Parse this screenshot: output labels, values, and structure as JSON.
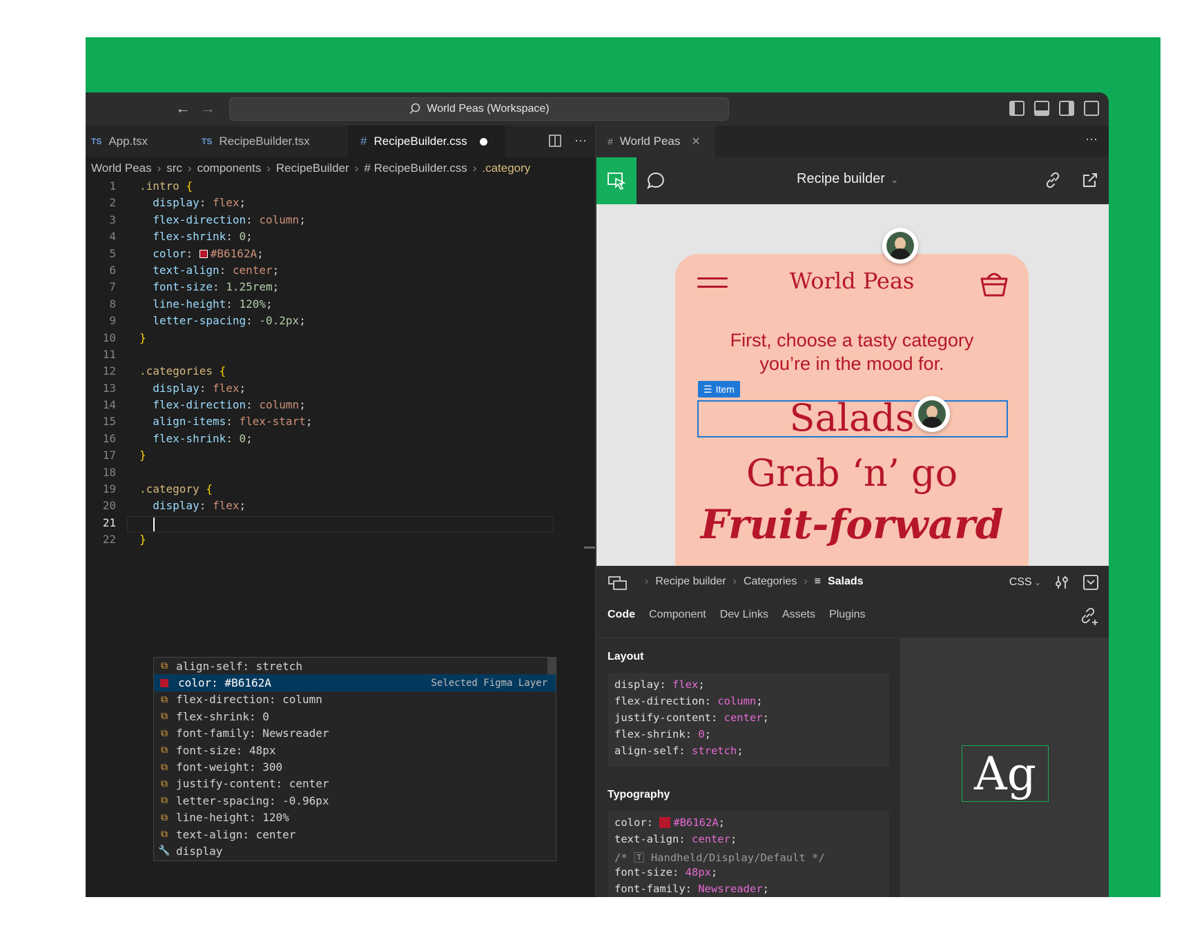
{
  "titlebar": {
    "back": "←",
    "forward": "→",
    "search_icon": "⌕",
    "workspace": "World Peas (Workspace)"
  },
  "editor": {
    "tabs": [
      {
        "lang": "TS",
        "label": "App.tsx"
      },
      {
        "lang": "TS",
        "label": "RecipeBuilder.tsx"
      },
      {
        "lang": "#",
        "label": "RecipeBuilder.css"
      }
    ],
    "breadcrumb": [
      "World Peas",
      "src",
      "components",
      "RecipeBuilder",
      "# RecipeBuilder.css",
      ".category"
    ],
    "lines": [
      {
        "n": "1",
        "html": "<span class=\"sel\">.intro</span> <span class=\"brace\">{</span>"
      },
      {
        "n": "2",
        "html": "  <span class=\"prop\">display</span>: <span class=\"val\">flex</span>;"
      },
      {
        "n": "3",
        "html": "  <span class=\"prop\">flex-direction</span>: <span class=\"val\">column</span>;"
      },
      {
        "n": "4",
        "html": "  <span class=\"prop\">flex-shrink</span>: <span class=\"num\">0</span>;"
      },
      {
        "n": "5",
        "html": "  <span class=\"prop\">color</span>: <span class=\"swatch\"></span><span class=\"val\">#B6162A</span>;"
      },
      {
        "n": "6",
        "html": "  <span class=\"prop\">text-align</span>: <span class=\"val\">center</span>;"
      },
      {
        "n": "7",
        "html": "  <span class=\"prop\">font-size</span>: <span class=\"num\">1.25rem</span>;"
      },
      {
        "n": "8",
        "html": "  <span class=\"prop\">line-height</span>: <span class=\"num\">120%</span>;"
      },
      {
        "n": "9",
        "html": "  <span class=\"prop\">letter-spacing</span>: <span class=\"num\">-0.2px</span>;"
      },
      {
        "n": "10",
        "html": "<span class=\"brace\">}</span>"
      },
      {
        "n": "11",
        "html": ""
      },
      {
        "n": "12",
        "html": "<span class=\"sel\">.categories</span> <span class=\"brace\">{</span>"
      },
      {
        "n": "13",
        "html": "  <span class=\"prop\">display</span>: <span class=\"val\">flex</span>;"
      },
      {
        "n": "14",
        "html": "  <span class=\"prop\">flex-direction</span>: <span class=\"val\">column</span>;"
      },
      {
        "n": "15",
        "html": "  <span class=\"prop\">align-items</span>: <span class=\"val\">flex-start</span>;"
      },
      {
        "n": "16",
        "html": "  <span class=\"prop\">flex-shrink</span>: <span class=\"num\">0</span>;"
      },
      {
        "n": "17",
        "html": "<span class=\"brace\">}</span>"
      },
      {
        "n": "18",
        "html": ""
      },
      {
        "n": "19",
        "html": "<span class=\"sel\">.category</span> <span class=\"brace\">{</span>"
      },
      {
        "n": "20",
        "html": "  <span class=\"prop\">display</span>: <span class=\"val\">flex</span>;"
      },
      {
        "n": "21",
        "html": ""
      },
      {
        "n": "22",
        "html": "<span class=\"brace\">}</span>"
      }
    ],
    "suggestions": [
      {
        "label": "align-self: stretch",
        "icon": "prop"
      },
      {
        "label": "color: #B6162A",
        "icon": "color",
        "hint": "Selected Figma Layer"
      },
      {
        "label": "flex-direction: column",
        "icon": "prop"
      },
      {
        "label": "flex-shrink: 0",
        "icon": "prop"
      },
      {
        "label": "font-family: Newsreader",
        "icon": "prop"
      },
      {
        "label": "font-size: 48px",
        "icon": "prop"
      },
      {
        "label": "font-weight: 300",
        "icon": "prop"
      },
      {
        "label": "justify-content: center",
        "icon": "prop"
      },
      {
        "label": "letter-spacing: -0.96px",
        "icon": "prop"
      },
      {
        "label": "line-height: 120%",
        "icon": "prop"
      },
      {
        "label": "text-align: center",
        "icon": "prop"
      },
      {
        "label": "display",
        "icon": "wrench"
      }
    ]
  },
  "figma": {
    "tab_label": "World Peas",
    "file_title": "Recipe builder",
    "phone": {
      "brand": "World Peas",
      "lead": "First, choose a tasty category you’re in the mood for.",
      "item_badge": "Item",
      "categories": [
        "Salads",
        "Grab ‘n’ go",
        "Fruit-forward"
      ]
    },
    "inspector": {
      "breadcrumb": [
        "Recipe builder",
        "Categories",
        "Salads"
      ],
      "lang": "CSS",
      "tabs": [
        "Code",
        "Component",
        "Dev Links",
        "Assets",
        "Plugins"
      ],
      "layout_title": "Layout",
      "layout_code": [
        {
          "p": "display",
          "v": "flex"
        },
        {
          "p": "flex-direction",
          "v": "column"
        },
        {
          "p": "justify-content",
          "v": "center"
        },
        {
          "p": "flex-shrink",
          "v": "0"
        },
        {
          "p": "align-self",
          "v": "stretch"
        }
      ],
      "typography_title": "Typography",
      "typo_color": "#B6162A",
      "typo_align": "center",
      "typo_comment": "/* 🅃 Handheld/Display/Default */",
      "typo_fontsize": "48px",
      "typo_family": "Newsreader",
      "preview": "Ag"
    }
  },
  "colors": {
    "brand_red": "#B6162A",
    "figma_green": "#14AE5C",
    "background_green": "#0FAA55",
    "selection_blue": "#1E78D7"
  }
}
